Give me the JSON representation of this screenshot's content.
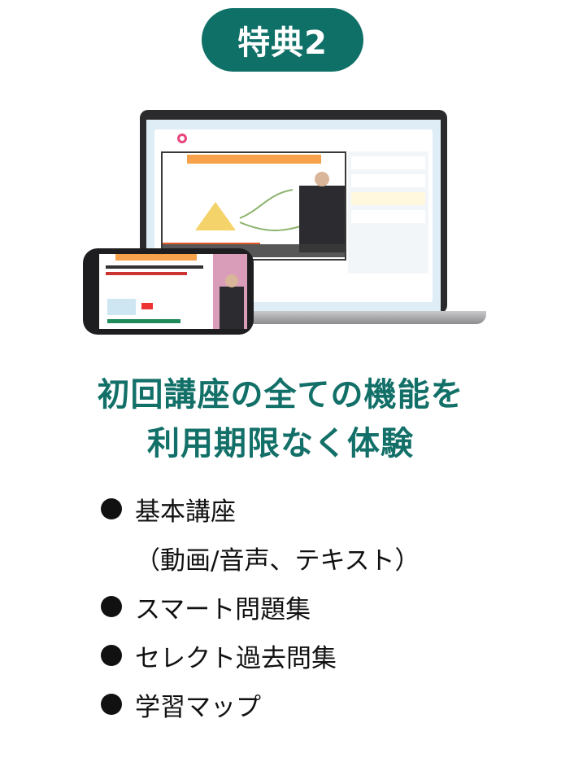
{
  "badge": {
    "label": "特典2",
    "color": "#0f7068"
  },
  "headline": {
    "line1": "初回講座の全ての機能を",
    "line2": "利用期限なく体験",
    "color": "#127068"
  },
  "features": [
    {
      "label": "基本講座",
      "bullet": true
    },
    {
      "label": "（動画/音声、テキスト）",
      "bullet": false
    },
    {
      "label": "スマート問題集",
      "bullet": true
    },
    {
      "label": "セレクト過去問集",
      "bullet": true
    },
    {
      "label": "学習マップ",
      "bullet": true
    }
  ]
}
